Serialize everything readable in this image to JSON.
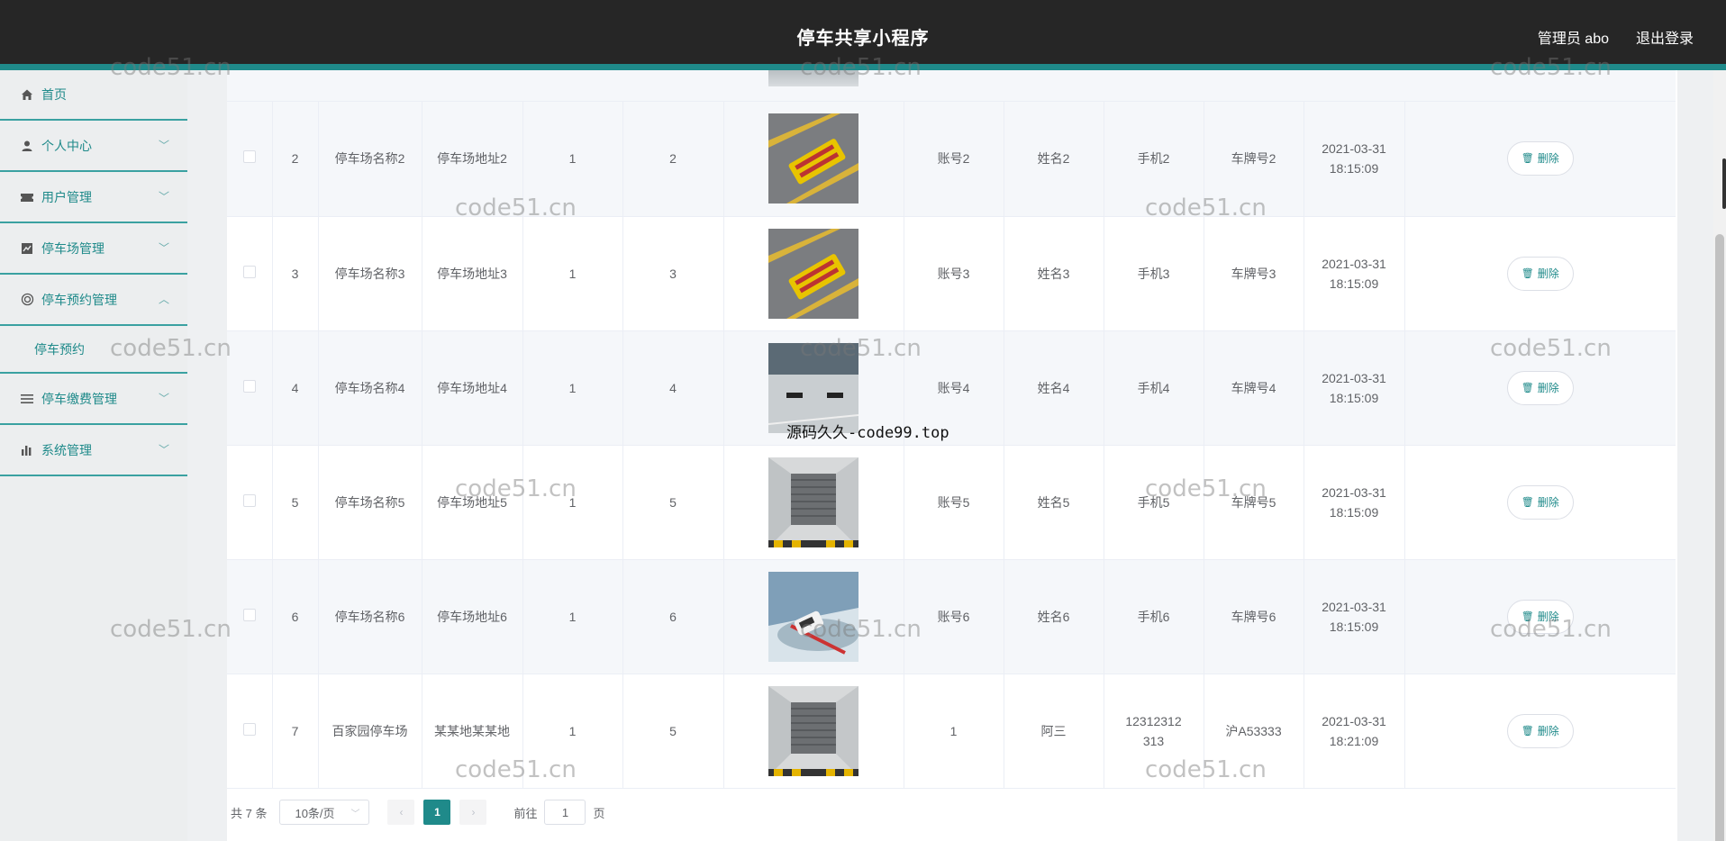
{
  "header": {
    "title": "停车共享小程序",
    "user": "管理员 abo",
    "logout": "退出登录"
  },
  "sidebar": {
    "items": [
      {
        "label": "首页",
        "icon": "home-icon",
        "chevron": ""
      },
      {
        "label": "个人中心",
        "icon": "user-icon",
        "chevron": "﹀"
      },
      {
        "label": "用户管理",
        "icon": "ticket-icon",
        "chevron": "﹀"
      },
      {
        "label": "停车场管理",
        "icon": "chart-icon",
        "chevron": "﹀"
      },
      {
        "label": "停车预约管理",
        "icon": "globe-icon",
        "chevron": "︿"
      },
      {
        "label": "停车预约",
        "sub": true
      },
      {
        "label": "停车缴费管理",
        "icon": "list-icon",
        "chevron": "﹀"
      },
      {
        "label": "系统管理",
        "icon": "bar-icon",
        "chevron": "﹀"
      }
    ]
  },
  "table": {
    "rows": [
      {
        "idx": "2",
        "name": "停车场名称2",
        "addr": "停车场地址2",
        "c1": "1",
        "c2": "2",
        "img": "yellow-marking",
        "account": "账号2",
        "person": "姓名2",
        "phone": "手机2",
        "plate": "车牌号2",
        "date": "2021-03-31",
        "time": "18:15:09"
      },
      {
        "idx": "3",
        "name": "停车场名称3",
        "addr": "停车场地址3",
        "c1": "1",
        "c2": "3",
        "img": "yellow-marking",
        "account": "账号3",
        "person": "姓名3",
        "phone": "手机3",
        "plate": "车牌号3",
        "date": "2021-03-31",
        "time": "18:15:09"
      },
      {
        "idx": "4",
        "name": "停车场名称4",
        "addr": "停车场地址4",
        "c1": "1",
        "c2": "4",
        "img": "garage-lot",
        "account": "账号4",
        "person": "姓名4",
        "phone": "手机4",
        "plate": "车牌号4",
        "date": "2021-03-31",
        "time": "18:15:09"
      },
      {
        "idx": "5",
        "name": "停车场名称5",
        "addr": "停车场地址5",
        "c1": "1",
        "c2": "5",
        "img": "garage-door",
        "account": "账号5",
        "person": "姓名5",
        "phone": "手机5",
        "plate": "车牌号5",
        "date": "2021-03-31",
        "time": "18:15:09"
      },
      {
        "idx": "6",
        "name": "停车场名称6",
        "addr": "停车场地址6",
        "c1": "1",
        "c2": "6",
        "img": "car-render",
        "account": "账号6",
        "person": "姓名6",
        "phone": "手机6",
        "plate": "车牌号6",
        "date": "2021-03-31",
        "time": "18:15:09"
      },
      {
        "idx": "7",
        "name": "百家园停车场",
        "addr": "某某地某某地",
        "c1": "1",
        "c2": "5",
        "img": "garage-door",
        "account": "1",
        "person": "阿三",
        "phone": "12312312313",
        "plate": "沪A53333",
        "date": "2021-03-31",
        "time": "18:21:09"
      }
    ],
    "delete_label": "删除"
  },
  "pager": {
    "total": "共 7 条",
    "size": "10条/页",
    "current": "1",
    "goto": "前往",
    "page_value": "1",
    "page_unit": "页"
  },
  "watermarks": {
    "text": "code51.cn",
    "center": "源码久久-code99.top"
  }
}
